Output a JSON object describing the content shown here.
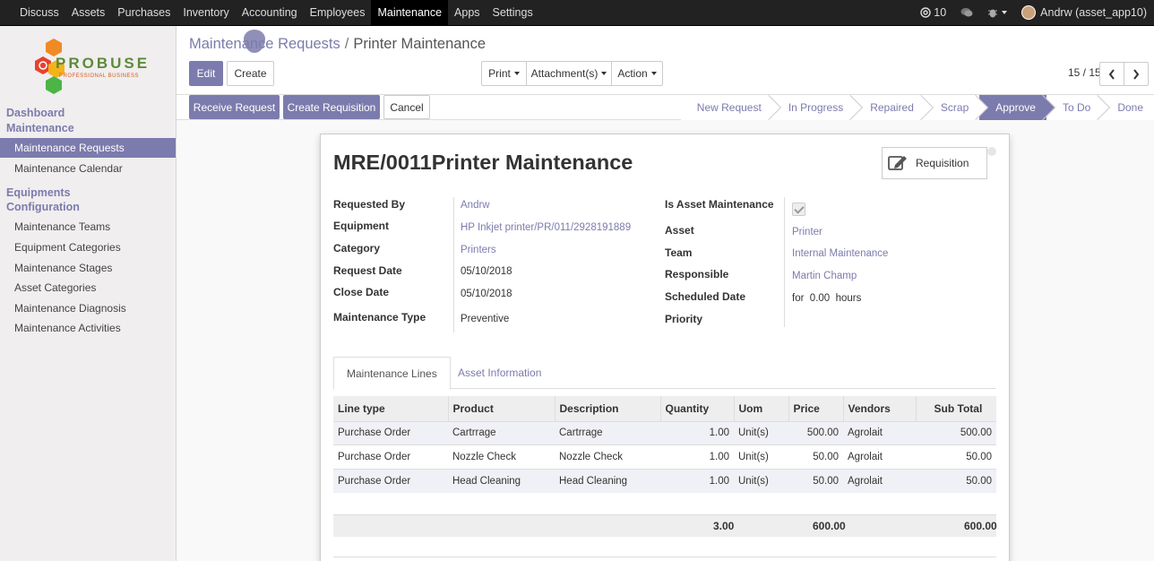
{
  "topbar": {
    "menu": [
      "Discuss",
      "Assets",
      "Purchases",
      "Inventory",
      "Accounting",
      "Employees",
      "Maintenance",
      "Apps",
      "Settings"
    ],
    "active_menu": "Maintenance",
    "messages_count": "10",
    "user": "Andrw (asset_app10)"
  },
  "sidebar": {
    "logo_text": "PROBUSE",
    "logo_sub": "PROFESSIONAL BUSINESS",
    "section1": "Dashboard",
    "section2": "Maintenance",
    "items_main": [
      "Maintenance Requests",
      "Maintenance Calendar"
    ],
    "section3": "Equipments",
    "section4": "Configuration",
    "items_config": [
      "Maintenance Teams",
      "Equipment Categories",
      "Maintenance Stages",
      "Asset Categories",
      "Maintenance Diagnosis",
      "Maintenance Activities"
    ]
  },
  "breadcrumb": {
    "parent": "Maintenance Requests",
    "separator": "/",
    "current": "Printer Maintenance"
  },
  "toolbar": {
    "edit": "Edit",
    "create": "Create",
    "print": "Print",
    "attachments": "Attachment(s)",
    "action": "Action",
    "pager": "15 / 15"
  },
  "statusbar": {
    "buttons": [
      "Receive Request",
      "Create Requisition",
      "Cancel"
    ],
    "stages": [
      "New Request",
      "In Progress",
      "Repaired",
      "Scrap",
      "Approve",
      "To Do",
      "Done"
    ],
    "active_stage": "Approve"
  },
  "form": {
    "title": "MRE/0011Printer Maintenance",
    "requisition_button": "Requisition",
    "left_labels": [
      "Requested By",
      "Equipment",
      "Category",
      "Request Date",
      "Close Date",
      "Maintenance Type"
    ],
    "left_values": [
      "Andrw",
      "HP Inkjet printer/PR/011/2928191889",
      "Printers",
      "05/10/2018",
      "05/10/2018",
      "Preventive"
    ],
    "right_labels": [
      "Is Asset Maintenance",
      "Asset",
      "Team",
      "Responsible",
      "Scheduled Date",
      "Priority"
    ],
    "right_values": [
      "",
      "Printer",
      "Internal Maintenance",
      "Martin Champ",
      "for  0.00  hours",
      ""
    ],
    "is_asset_maintenance": true
  },
  "tabs": [
    "Maintenance Lines",
    "Asset Information"
  ],
  "lines": {
    "columns": [
      "Line type",
      "Product",
      "Description",
      "Quantity",
      "Uom",
      "Price",
      "Vendors",
      "Sub Total"
    ],
    "rows": [
      [
        "Purchase Order",
        "Cartrrage",
        "Cartrrage",
        "1.00",
        "Unit(s)",
        "500.00",
        "Agrolait",
        "500.00"
      ],
      [
        "Purchase Order",
        "Nozzle Check",
        "Nozzle Check",
        "1.00",
        "Unit(s)",
        "50.00",
        "Agrolait",
        "50.00"
      ],
      [
        "Purchase Order",
        "Head Cleaning",
        "Head Cleaning",
        "1.00",
        "Unit(s)",
        "50.00",
        "Agrolait",
        "50.00"
      ]
    ],
    "totals": {
      "quantity": "3.00",
      "price": "600.00",
      "subtotal": "600.00"
    }
  },
  "colors": {
    "brand": "#7c7bad",
    "topbar": "#222222"
  }
}
